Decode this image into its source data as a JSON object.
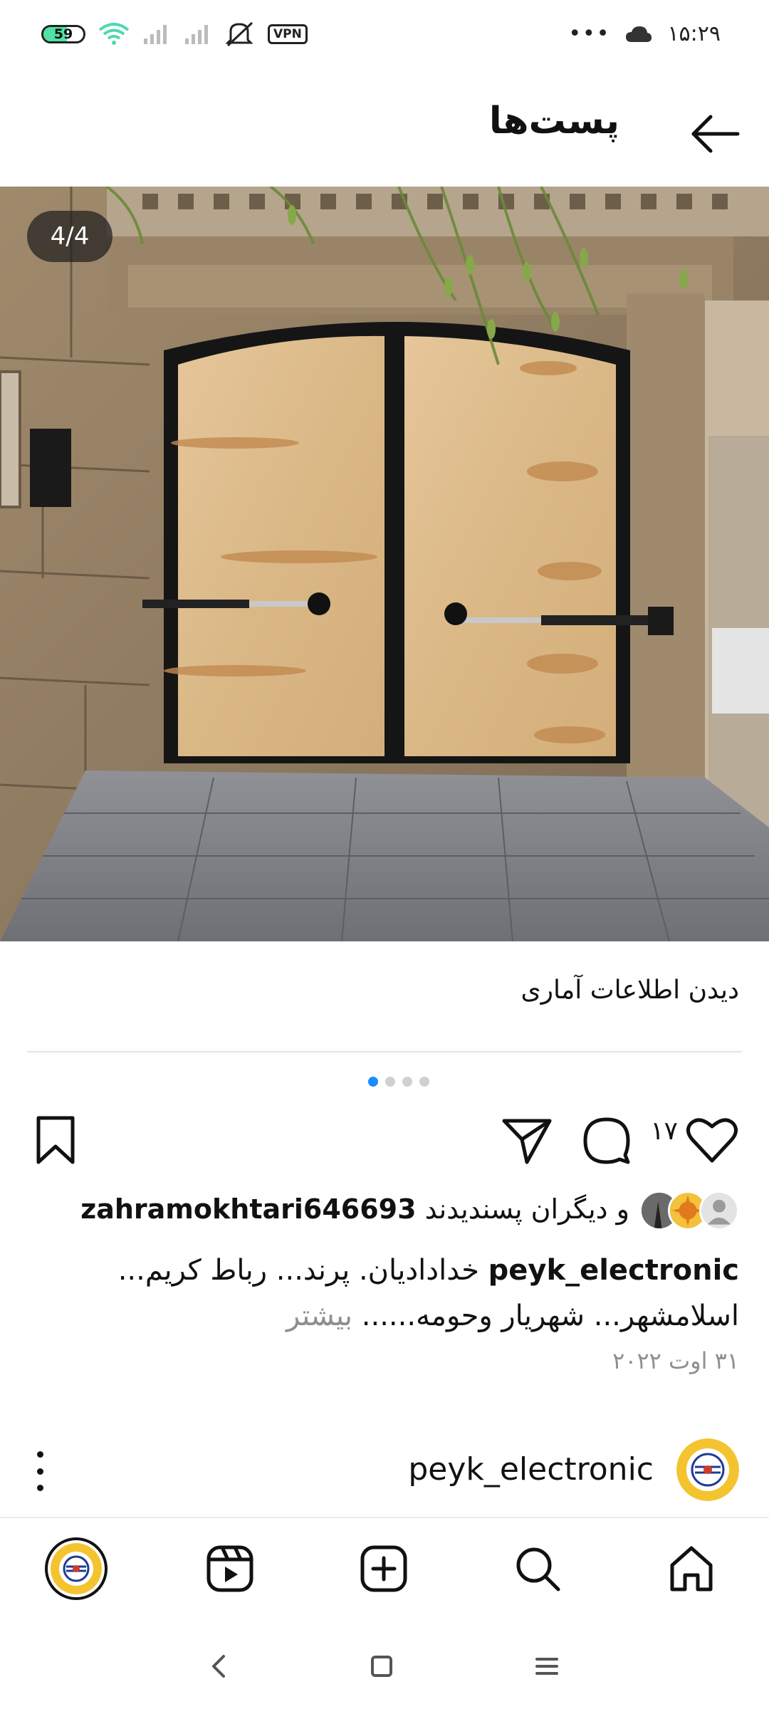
{
  "status_bar": {
    "battery_level": "59",
    "battery_fraction": 0.59,
    "vpn_label": "VPN",
    "more_dots": "•••",
    "time": "۱۵:۲۹",
    "icons": [
      "battery-icon",
      "wifi-icon",
      "signal-icon",
      "signal-icon",
      "mute-icon",
      "vpn-icon",
      "cloud-icon"
    ]
  },
  "header": {
    "title": "پست‌ها",
    "back_icon": "arrow-left-icon"
  },
  "post": {
    "image_counter": "4/4",
    "image_description_icon": "gate-photo",
    "insights_link": "دیدن اطلاعات آماری",
    "carousel": {
      "total": 4,
      "active": 1
    },
    "like_count": "۱۷",
    "liked_by_user": "zahramokhtari646693",
    "liked_by_suffix": "و دیگران پسندیدند",
    "caption_user": "peyk_electronic",
    "caption_text": "خدادادیان. پرند... رباط کریم... اسلامشهر... شهریار وحومه......",
    "caption_more": "بیشتر",
    "date": "۳۱ اوت ۲۰۲۲"
  },
  "next_post": {
    "username": "peyk_electronic"
  },
  "bottom_nav": {
    "items": [
      "profile-avatar",
      "reels-icon",
      "create-icon",
      "search-icon",
      "home-icon"
    ]
  },
  "system_nav": {
    "items": [
      "back-icon",
      "home-square-icon",
      "menu-icon"
    ]
  },
  "colors": {
    "accent": "#1a8cff",
    "muted_text": "#8e8e8e",
    "battery_fill": "#4fe3a4"
  }
}
